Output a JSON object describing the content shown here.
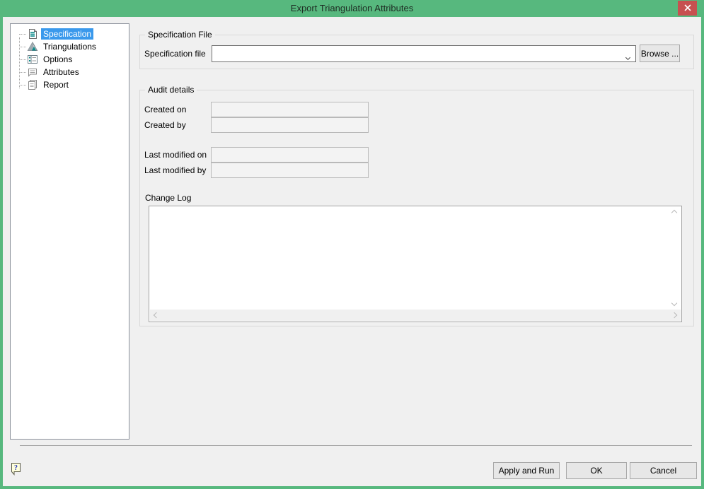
{
  "window": {
    "title": "Export Triangulation Attributes",
    "close_icon": "close-x"
  },
  "sidebar": {
    "items": [
      {
        "label": "Specification",
        "icon": "specification-icon",
        "selected": true
      },
      {
        "label": "Triangulations",
        "icon": "triangulations-icon",
        "selected": false
      },
      {
        "label": "Options",
        "icon": "options-icon",
        "selected": false
      },
      {
        "label": "Attributes",
        "icon": "attributes-icon",
        "selected": false
      },
      {
        "label": "Report",
        "icon": "report-icon",
        "selected": false
      }
    ]
  },
  "main": {
    "spec_group": {
      "title": "Specification File",
      "file_label": "Specification file",
      "file_value": "",
      "browse_label": "Browse ..."
    },
    "audit_group": {
      "title": "Audit details",
      "created_on_label": "Created on",
      "created_on_value": "",
      "created_by_label": "Created by",
      "created_by_value": "",
      "last_modified_on_label": "Last modified on",
      "last_modified_on_value": "",
      "last_modified_by_label": "Last modified by",
      "last_modified_by_value": "",
      "change_log_label": "Change Log",
      "change_log_value": ""
    }
  },
  "footer": {
    "help_icon": "help-balloon-icon",
    "apply_run_label": "Apply and Run",
    "ok_label": "OK",
    "cancel_label": "Cancel"
  },
  "colors": {
    "titlebar_green": "#57b87e",
    "close_red": "#c75050",
    "selection_blue": "#3a99ec",
    "dialog_bg": "#f0f0f0",
    "teal_accent": "#0b8a8a"
  }
}
